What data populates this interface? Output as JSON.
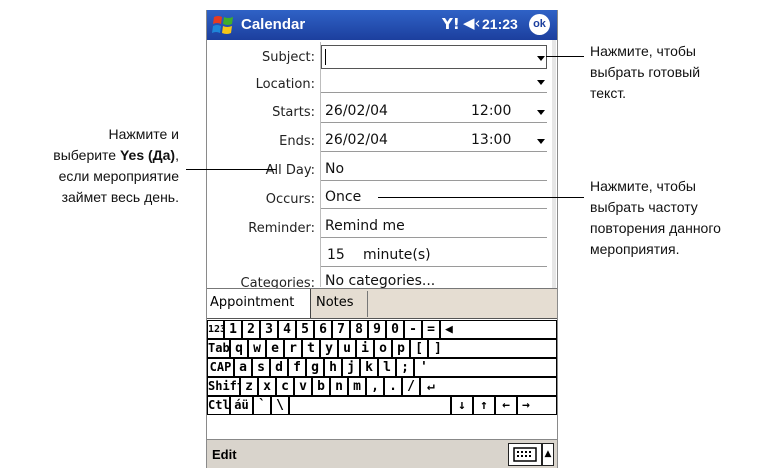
{
  "titlebar": {
    "title": "Calendar",
    "time": "21:23",
    "ok_label": "ok",
    "signal_glyph": "Y!",
    "volume_glyph": "◀‹"
  },
  "form": {
    "subject_label": "Subject:",
    "location_label": "Location:",
    "starts_label": "Starts:",
    "starts_date": "26/02/04",
    "starts_time": "12:00",
    "ends_label": "Ends:",
    "ends_date": "26/02/04",
    "ends_time": "13:00",
    "allday_label": "All Day:",
    "allday_value": "No",
    "occurs_label": "Occurs:",
    "occurs_value": "Once",
    "reminder_label": "Reminder:",
    "reminder_value": "Remind me",
    "reminder_amount": "15",
    "reminder_unit": "minute(s)",
    "categories_label": "Categories:",
    "categories_value": "No categories..."
  },
  "tabs": {
    "appointment": "Appointment",
    "notes": "Notes"
  },
  "keyboard": {
    "rows": [
      [
        "123",
        "1",
        "2",
        "3",
        "4",
        "5",
        "6",
        "7",
        "8",
        "9",
        "0",
        "-",
        "=",
        "◀"
      ],
      [
        "Tab",
        "q",
        "w",
        "e",
        "r",
        "t",
        "y",
        "u",
        "i",
        "o",
        "p",
        "[",
        "]"
      ],
      [
        "CAP",
        "a",
        "s",
        "d",
        "f",
        "g",
        "h",
        "j",
        "k",
        "l",
        ";",
        "'"
      ],
      [
        "Shift",
        "z",
        "x",
        "c",
        "v",
        "b",
        "n",
        "m",
        ",",
        ".",
        "/",
        "↵"
      ],
      [
        "Ctl",
        "áü",
        "`",
        "\\",
        "",
        "↓",
        "↑",
        "←",
        "→"
      ]
    ]
  },
  "menubar": {
    "edit": "Edit",
    "keyboard_glyph": "▦",
    "arrow_glyph": "▲"
  },
  "callouts": {
    "subject": [
      "Нажмите, чтобы",
      "выбрать готовый",
      "текст."
    ],
    "allday": {
      "line1": "Нажмите и",
      "line2_pre": "выберите ",
      "line2_bold": "Yes (Да)",
      "line2_post": ",",
      "line3": "если мероприятие",
      "line4": "займет весь день."
    },
    "occurs": [
      "Нажмите, чтобы",
      "выбрать частоту",
      "повторения данного",
      "мероприятия."
    ]
  },
  "colors": {
    "titlebar": "#1c3f9e",
    "tabbar": "#e5ddd2",
    "menubar": "#d9d4cc"
  }
}
